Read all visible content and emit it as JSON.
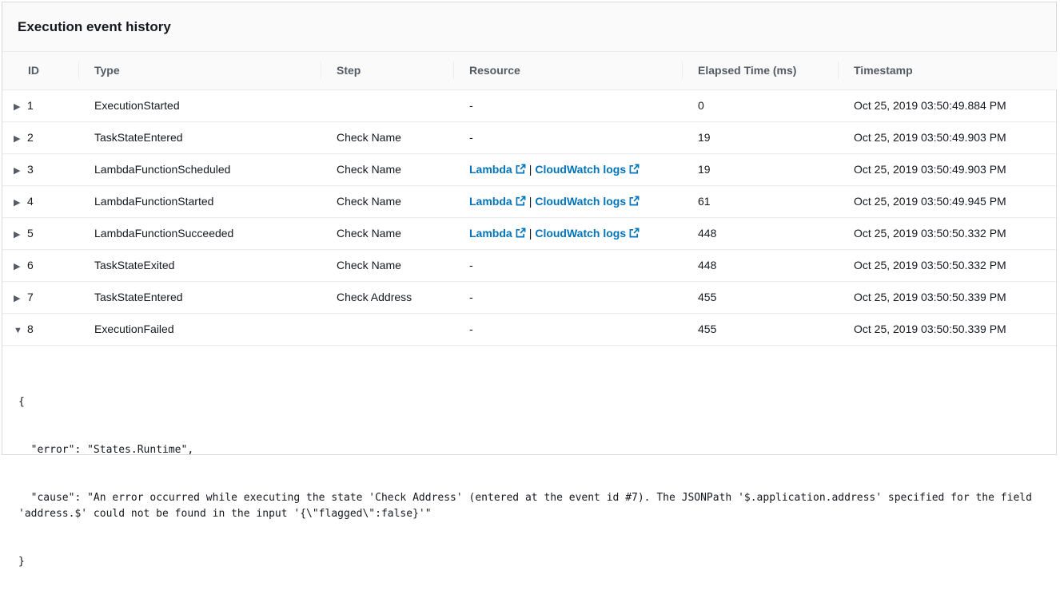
{
  "panel": {
    "title": "Execution event history"
  },
  "columns": [
    "ID",
    "Type",
    "Step",
    "Resource",
    "Elapsed Time (ms)",
    "Timestamp"
  ],
  "rows": [
    {
      "id": "1",
      "caret": "▶",
      "type": "ExecutionStarted",
      "step": "",
      "resource": "-",
      "elapsed": "0",
      "timestamp": "Oct 25, 2019 03:50:49.884 PM"
    },
    {
      "id": "2",
      "caret": "▶",
      "type": "TaskStateEntered",
      "step": "Check Name",
      "resource": "-",
      "elapsed": "19",
      "timestamp": "Oct 25, 2019 03:50:49.903 PM"
    },
    {
      "id": "3",
      "caret": "▶",
      "type": "LambdaFunctionScheduled",
      "step": "Check Name",
      "resource_links": [
        "Lambda",
        "CloudWatch logs"
      ],
      "elapsed": "19",
      "timestamp": "Oct 25, 2019 03:50:49.903 PM"
    },
    {
      "id": "4",
      "caret": "▶",
      "type": "LambdaFunctionStarted",
      "step": "Check Name",
      "resource_links": [
        "Lambda",
        "CloudWatch logs"
      ],
      "elapsed": "61",
      "timestamp": "Oct 25, 2019 03:50:49.945 PM"
    },
    {
      "id": "5",
      "caret": "▶",
      "type": "LambdaFunctionSucceeded",
      "step": "Check Name",
      "resource_links": [
        "Lambda",
        "CloudWatch logs"
      ],
      "elapsed": "448",
      "timestamp": "Oct 25, 2019 03:50:50.332 PM"
    },
    {
      "id": "6",
      "caret": "▶",
      "type": "TaskStateExited",
      "step": "Check Name",
      "resource": "-",
      "elapsed": "448",
      "timestamp": "Oct 25, 2019 03:50:50.332 PM"
    },
    {
      "id": "7",
      "caret": "▶",
      "type": "TaskStateEntered",
      "step": "Check Address",
      "resource": "-",
      "elapsed": "455",
      "timestamp": "Oct 25, 2019 03:50:50.339 PM"
    },
    {
      "id": "8",
      "caret": "▼",
      "type": "ExecutionFailed",
      "step": "",
      "resource": "-",
      "elapsed": "455",
      "timestamp": "Oct 25, 2019 03:50:50.339 PM"
    }
  ],
  "details": {
    "lines": [
      "{",
      "  \"error\": \"States.Runtime\",",
      "  \"cause\": \"An error occurred while executing the state 'Check Address' (entered at the event id #7). The JSONPath '$.application.address' specified for the field 'address.$' could not be found in the input '{\\\"flagged\\\":false}'\"",
      "}"
    ]
  },
  "colors": {
    "link": "#0073bb",
    "header_bg": "#fafafa",
    "border": "#eaeded"
  },
  "icons": {
    "expand": "caret-right-icon",
    "collapse": "caret-down-icon",
    "external": "external-link-icon"
  }
}
